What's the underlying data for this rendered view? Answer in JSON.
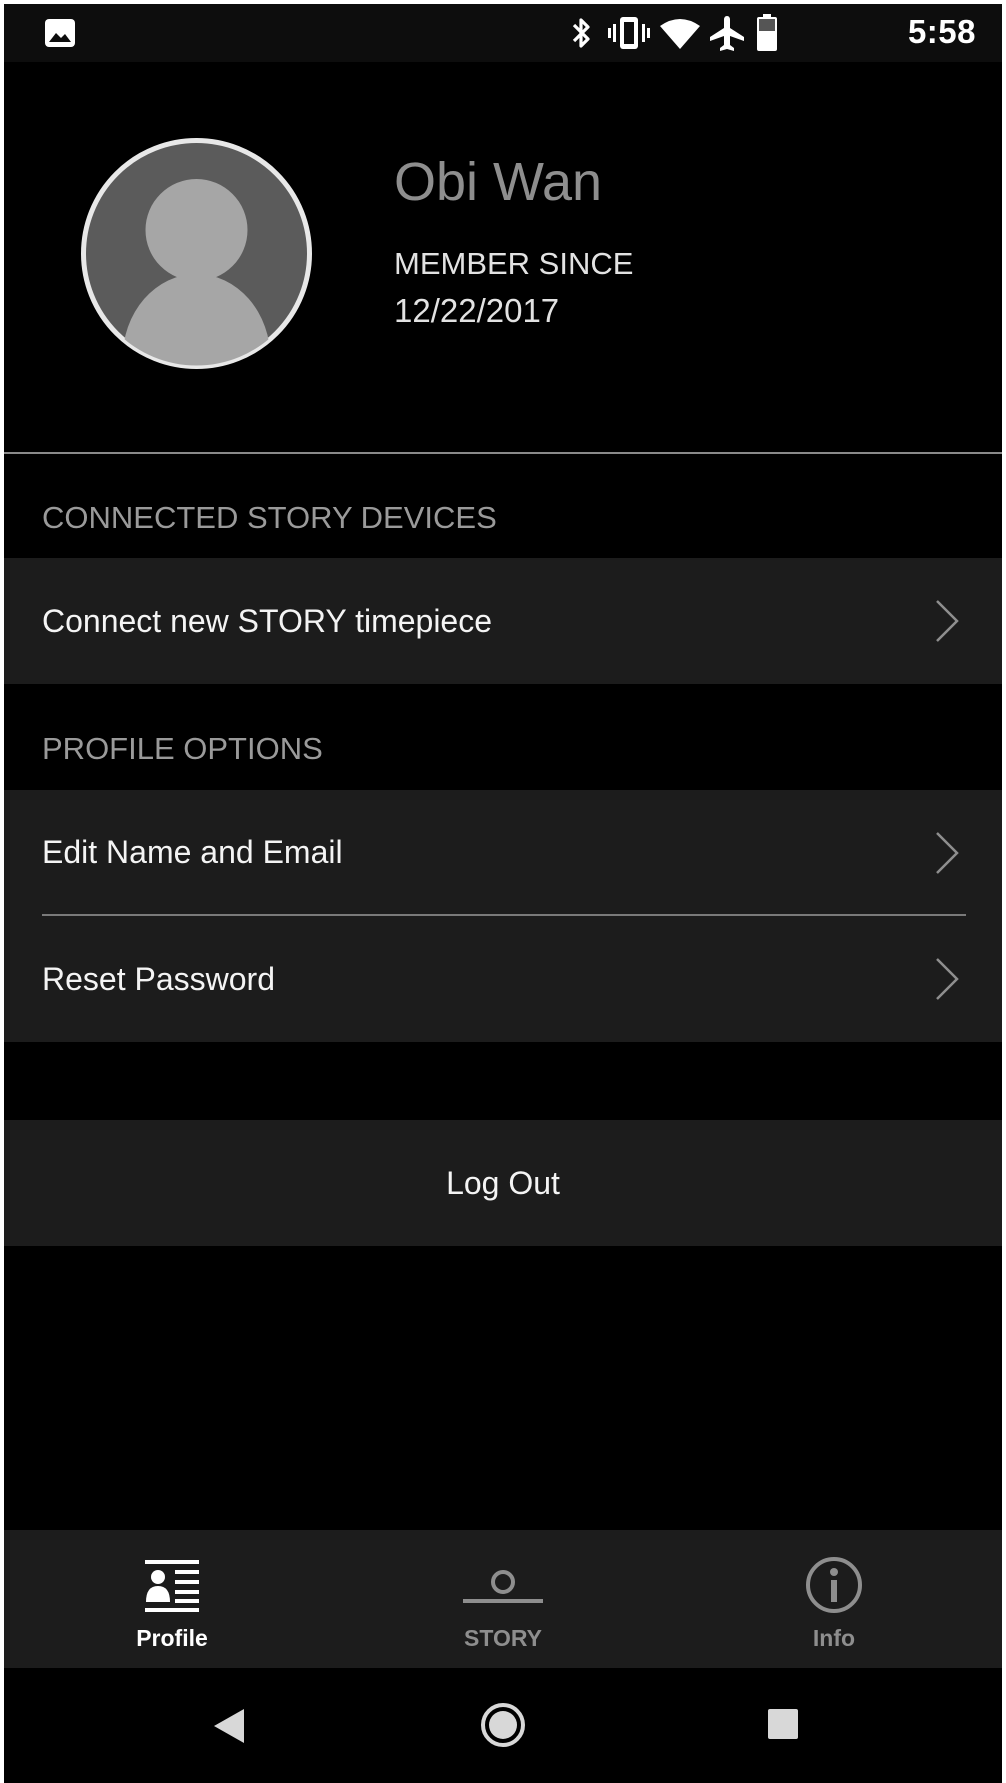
{
  "status_bar": {
    "time": "5:58",
    "icons": [
      "image-notification-icon",
      "bluetooth-icon",
      "vibrate-icon",
      "wifi-icon",
      "airplane-mode-icon",
      "battery-icon"
    ]
  },
  "profile": {
    "name": "Obi Wan",
    "member_since_label": "MEMBER SINCE",
    "member_since_date": "12/22/2017",
    "avatar_icon": "avatar-placeholder-icon"
  },
  "sections": {
    "devices": {
      "header": "CONNECTED STORY DEVICES",
      "items": [
        {
          "label": "Connect new STORY timepiece"
        }
      ]
    },
    "options": {
      "header": "PROFILE OPTIONS",
      "items": [
        {
          "label": "Edit Name and Email"
        },
        {
          "label": "Reset Password"
        }
      ]
    }
  },
  "logout": {
    "label": "Log Out"
  },
  "tab_bar": {
    "tabs": [
      {
        "label": "Profile",
        "icon": "profile-card-icon",
        "active": true
      },
      {
        "label": "STORY",
        "icon": "story-watch-icon",
        "active": false
      },
      {
        "label": "Info",
        "icon": "info-icon",
        "active": false
      }
    ]
  },
  "nav_bar": {
    "buttons": [
      "back-icon",
      "home-icon",
      "recents-icon"
    ]
  },
  "colors": {
    "background": "#000000",
    "row_background": "#1c1c1c",
    "section_header_text": "#9a9a9a",
    "name_text": "#8e8e8e",
    "active_tab": "#ffffff",
    "inactive_tab": "#8e8e8e"
  }
}
